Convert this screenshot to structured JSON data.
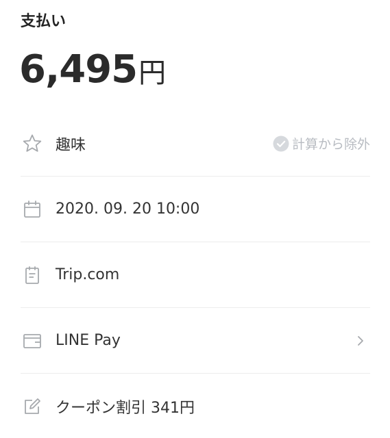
{
  "header": {
    "title": "支払い"
  },
  "amount": {
    "value": "6,495",
    "unit": "円"
  },
  "category": {
    "icon": "star-icon",
    "label": "趣味",
    "exclude_label": "計算から除外",
    "exclude_icon": "check-circle-icon",
    "exclude_checked": false
  },
  "datetime": {
    "icon": "calendar-icon",
    "value": "2020. 09. 20 10:00"
  },
  "store": {
    "icon": "receipt-icon",
    "value": "Trip.com"
  },
  "payment_method": {
    "icon": "wallet-icon",
    "value": "LINE Pay",
    "chevron_icon": "chevron-right-icon"
  },
  "memo": {
    "icon": "edit-icon",
    "value": "クーポン割引 341円"
  },
  "colors": {
    "text": "#333333",
    "muted": "#b8bcc2",
    "icon": "#a6a9ad",
    "divider": "#ececec"
  }
}
